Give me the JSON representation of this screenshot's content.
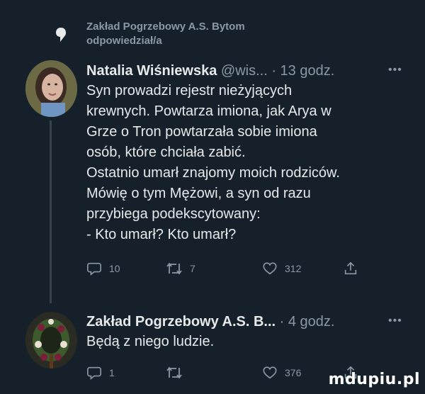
{
  "context": {
    "line1": "Zakład Pogrzebowy A.S. Bytom",
    "line2": "odpowiedział/a",
    "icon": "comment-bubble-icon"
  },
  "tweets": [
    {
      "author": "Natalia Wiśniewska",
      "handle": "@wis...",
      "time": "· 13 godz.",
      "more": "•••",
      "lines": [
        "Syn prowadzi rejestr nieżyjących",
        "krewnych. Powtarza imiona, jak Arya w",
        "Grze o Tron powtarzała sobie imiona",
        "osób, które chciała zabić.",
        "Ostatnio umarł znajomy moich rodziców.",
        "Mówię o tym Mężowi, a syn od razu",
        "przybiega podekscytowany:",
        "- Kto umarł? Kto umarł?"
      ],
      "replies": "10",
      "retweets": "7",
      "likes": "312"
    },
    {
      "author": "Zakład Pogrzebowy A.S. B...",
      "time": "· 4 godz.",
      "more": "•••",
      "lines": [
        "Będą z niego ludzie."
      ],
      "replies": "1",
      "retweets": "",
      "likes": "376"
    }
  ],
  "watermark": "mdupiu.pl",
  "colors": {
    "background": "#15202b",
    "text": "#e7e9ea",
    "muted": "#8b98a5",
    "thread": "#38444d"
  }
}
